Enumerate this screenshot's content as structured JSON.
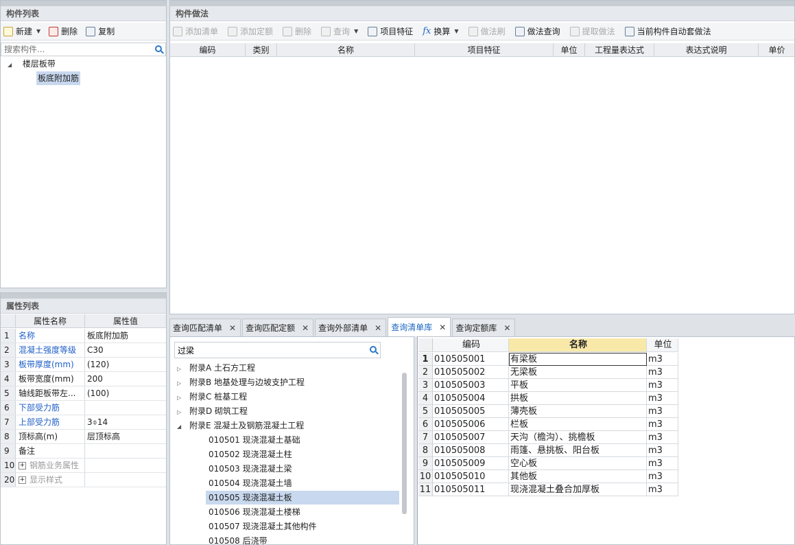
{
  "component_list": {
    "title": "构件列表",
    "toolbar": {
      "new_label": "新建",
      "delete_label": "删除",
      "copy_label": "复制"
    },
    "search_placeholder": "搜索构件...",
    "tree": {
      "root": "楼层板带",
      "child": "板底附加筋"
    }
  },
  "properties": {
    "title": "属性列表",
    "headers": {
      "name": "属性名称",
      "value": "属性值"
    },
    "rows": [
      {
        "num": "1",
        "name": "名称",
        "value": "板底附加筋",
        "blue": true
      },
      {
        "num": "2",
        "name": "混凝土强度等级",
        "value": "C30",
        "blue": true
      },
      {
        "num": "3",
        "name": "板带厚度(mm)",
        "value": "(120)",
        "blue": true
      },
      {
        "num": "4",
        "name": "板带宽度(mm)",
        "value": "200",
        "blue": false
      },
      {
        "num": "5",
        "name": "轴线距板带左...",
        "value": "(100)",
        "blue": false
      },
      {
        "num": "6",
        "name": "下部受力筋",
        "value": "",
        "blue": true
      },
      {
        "num": "7",
        "name": "上部受力筋",
        "value": "3⌽14",
        "blue": true
      },
      {
        "num": "8",
        "name": "顶标高(m)",
        "value": "层顶标高",
        "blue": false
      },
      {
        "num": "9",
        "name": "备注",
        "value": "",
        "blue": false
      },
      {
        "num": "10",
        "name": "钢筋业务属性",
        "value": "",
        "blue": false,
        "expand": true
      },
      {
        "num": "20",
        "name": "显示样式",
        "value": "",
        "blue": false,
        "expand": true
      }
    ]
  },
  "method": {
    "title": "构件做法",
    "toolbar": [
      "添加清单",
      "添加定额",
      "删除",
      "查询",
      "项目特征",
      "换算",
      "做法刷",
      "做法查询",
      "提取做法",
      "当前构件自动套做法"
    ],
    "toolbar_disabled": [
      true,
      true,
      true,
      true,
      false,
      false,
      true,
      false,
      true,
      false
    ],
    "columns": [
      "编码",
      "类别",
      "名称",
      "项目特征",
      "单位",
      "工程量表达式",
      "表达式说明",
      "单价"
    ]
  },
  "tabs": [
    {
      "label": "查询匹配清单",
      "active": false
    },
    {
      "label": "查询匹配定额",
      "active": false
    },
    {
      "label": "查询外部清单",
      "active": false
    },
    {
      "label": "查询清单库",
      "active": true
    },
    {
      "label": "查询定额库",
      "active": false
    }
  ],
  "library": {
    "search_value": "过梁",
    "chapters": [
      {
        "label": "附录A 土石方工程",
        "expanded": false
      },
      {
        "label": "附录B 地基处理与边坡支护工程",
        "expanded": false
      },
      {
        "label": "附录C 桩基工程",
        "expanded": false
      },
      {
        "label": "附录D 砌筑工程",
        "expanded": false
      },
      {
        "label": "附录E 混凝土及钢筋混凝土工程",
        "expanded": true
      }
    ],
    "sections": [
      {
        "label": "010501 现浇混凝土基础",
        "selected": false
      },
      {
        "label": "010502 现浇混凝土柱",
        "selected": false
      },
      {
        "label": "010503 现浇混凝土梁",
        "selected": false
      },
      {
        "label": "010504 现浇混凝土墙",
        "selected": false
      },
      {
        "label": "010505 现浇混凝土板",
        "selected": true
      },
      {
        "label": "010506 现浇混凝土楼梯",
        "selected": false
      },
      {
        "label": "010507 现浇混凝土其他构件",
        "selected": false
      },
      {
        "label": "010508 后浇带",
        "selected": false
      }
    ]
  },
  "results": {
    "headers": {
      "code": "编码",
      "name": "名称",
      "unit": "单位"
    },
    "rows": [
      {
        "num": "1",
        "code": "010505001",
        "name": "有梁板",
        "unit": "m3"
      },
      {
        "num": "2",
        "code": "010505002",
        "name": "无梁板",
        "unit": "m3"
      },
      {
        "num": "3",
        "code": "010505003",
        "name": "平板",
        "unit": "m3"
      },
      {
        "num": "4",
        "code": "010505004",
        "name": "拱板",
        "unit": "m3"
      },
      {
        "num": "5",
        "code": "010505005",
        "name": "薄壳板",
        "unit": "m3"
      },
      {
        "num": "6",
        "code": "010505006",
        "name": "栏板",
        "unit": "m3"
      },
      {
        "num": "7",
        "code": "010505007",
        "name": "天沟（檐沟）、挑檐板",
        "unit": "m3"
      },
      {
        "num": "8",
        "code": "010505008",
        "name": "雨篷、悬挑板、阳台板",
        "unit": "m3"
      },
      {
        "num": "9",
        "code": "010505009",
        "name": "空心板",
        "unit": "m3"
      },
      {
        "num": "10",
        "code": "010505010",
        "name": "其他板",
        "unit": "m3"
      },
      {
        "num": "11",
        "code": "010505011",
        "name": "现浇混凝土叠合加厚板",
        "unit": "m3"
      }
    ]
  },
  "colors": {
    "accent": "#1d66c2",
    "selected_row": "#c8d8ee",
    "header_highlight": "#f9e9a8"
  }
}
